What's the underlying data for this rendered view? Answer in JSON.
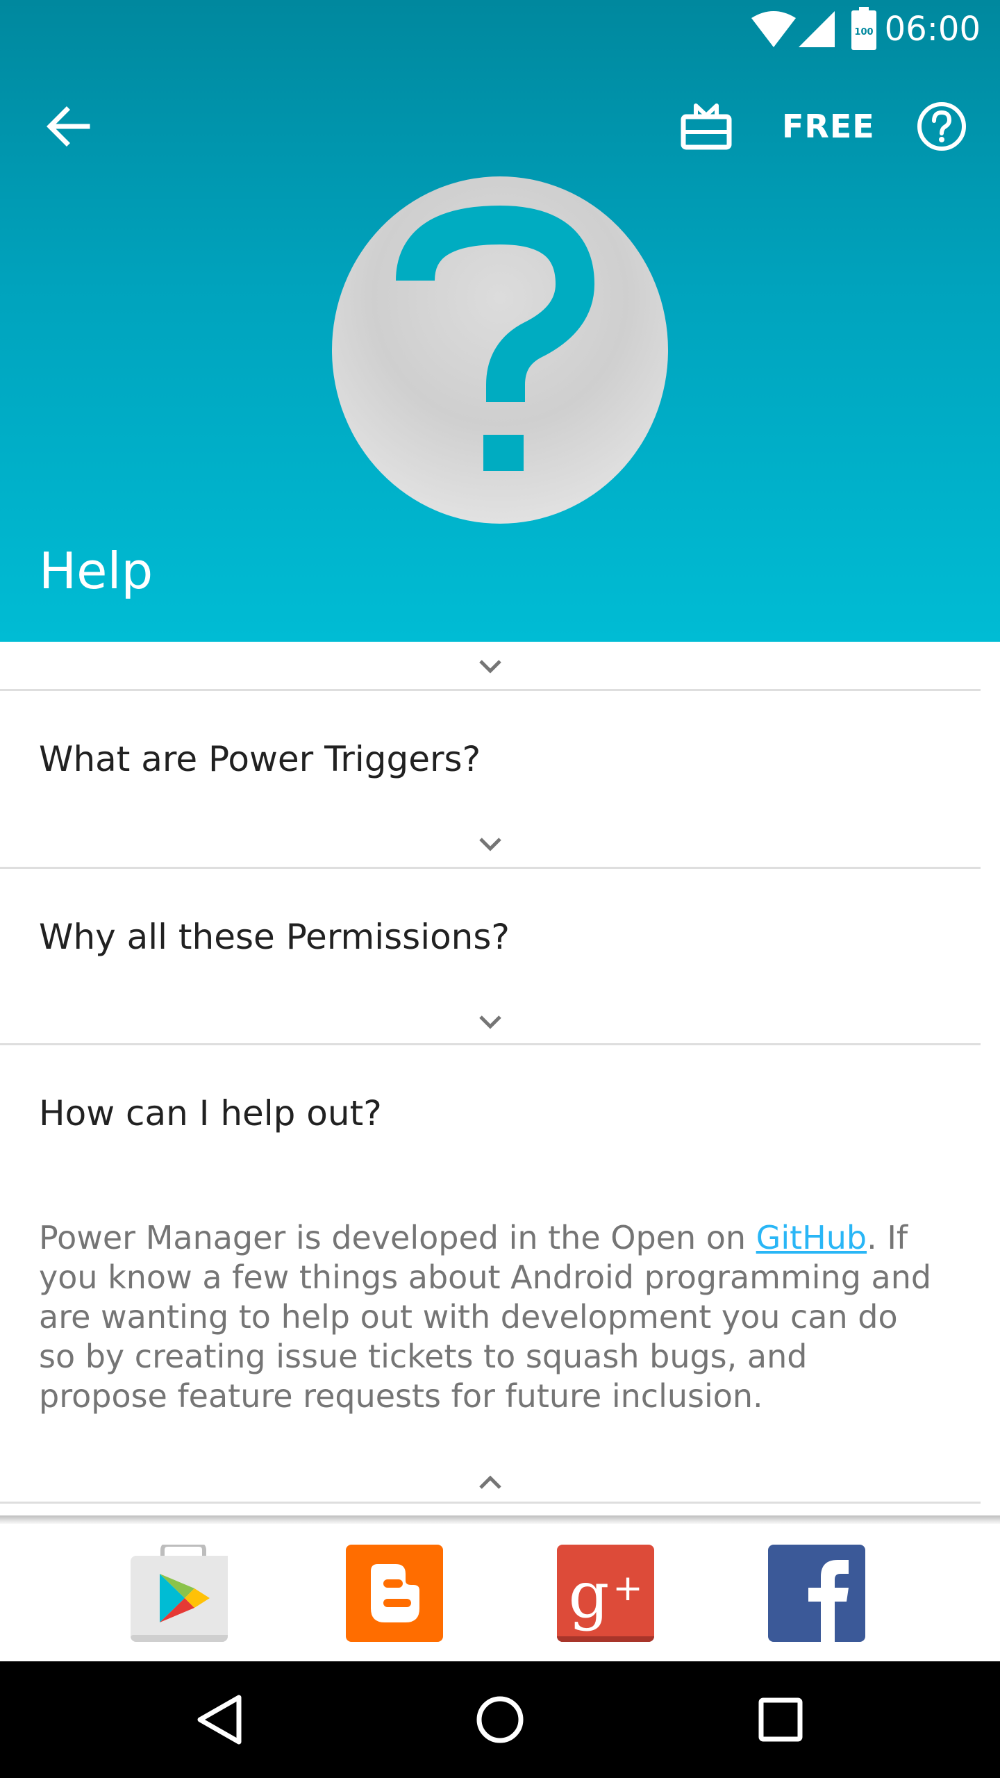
{
  "status_bar": {
    "time": "06:00",
    "battery_level": "100",
    "icons": [
      "wifi-icon",
      "signal-icon",
      "battery-icon"
    ]
  },
  "toolbar": {
    "back_icon": "arrow-left-icon",
    "gift_icon": "gift-card-icon",
    "free_label": "FREE",
    "help_icon": "help-circle-icon"
  },
  "hero": {
    "icon": "question-mark-icon"
  },
  "page": {
    "title": "Help"
  },
  "faq": {
    "items": [
      {
        "question": "What are Power Triggers?",
        "expanded": false
      },
      {
        "question": "Why all these Permissions?",
        "expanded": false
      },
      {
        "question": "How can I help out?",
        "expanded": true
      }
    ],
    "answer": {
      "before_link": "Power Manager is developed in the Open on ",
      "link_text": "GitHub",
      "after_link": ". If you know a few things about Android programming and are wanting to help out with development you can do so by creating issue tickets to squash bugs, and propose feature requests for future inclusion."
    }
  },
  "social": [
    {
      "name": "Google Play",
      "icon": "google-play-icon"
    },
    {
      "name": "Blogger",
      "icon": "blogger-icon"
    },
    {
      "name": "Google+",
      "icon": "google-plus-icon"
    },
    {
      "name": "Facebook",
      "icon": "facebook-icon"
    }
  ],
  "nav": [
    "back-triangle-icon",
    "home-circle-icon",
    "recents-square-icon"
  ],
  "colors": {
    "header_top": "#00889e",
    "header_bottom": "#00bcd4",
    "accent_teal": "#00acc1",
    "link": "#29b6f6",
    "question_text": "#212121",
    "answer_text": "#757575",
    "blogger": "#ff6d00",
    "google_plus": "#dd4b39",
    "facebook": "#3b5998"
  }
}
